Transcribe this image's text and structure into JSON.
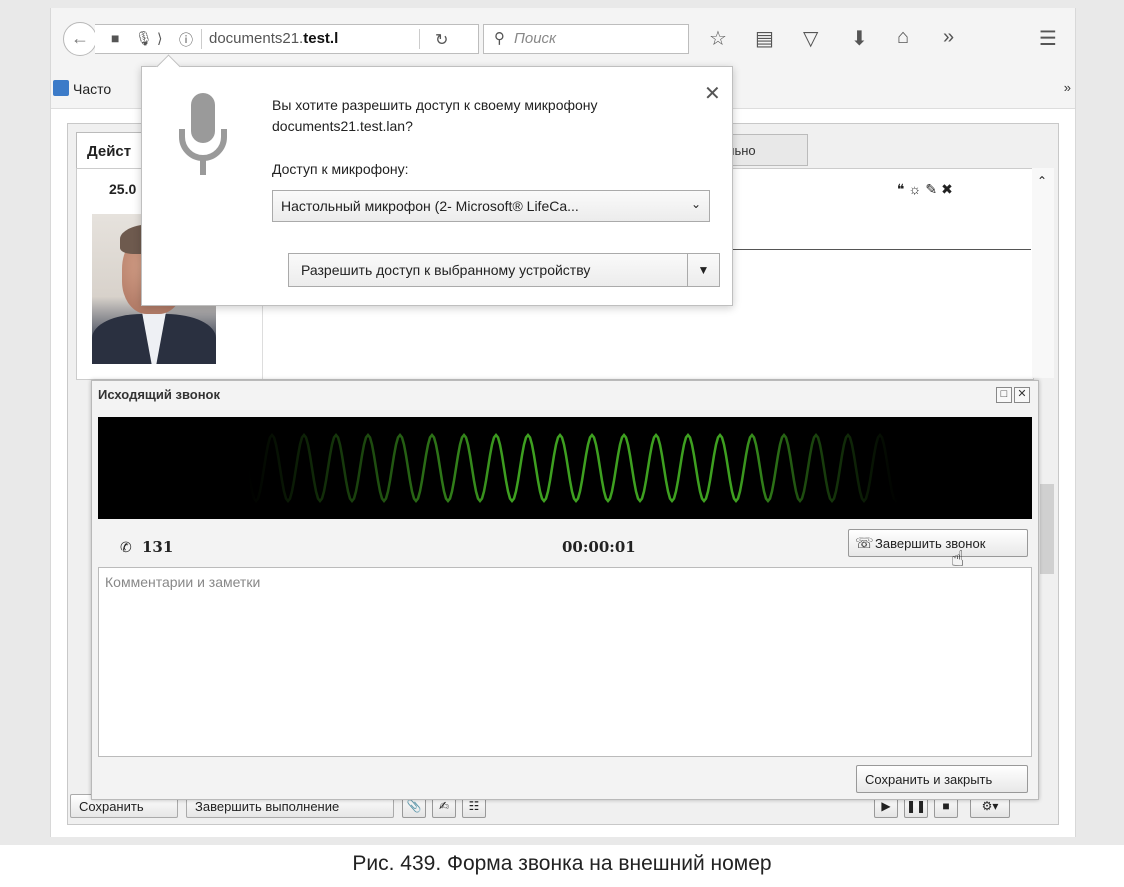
{
  "browser": {
    "url_prefix": "documents21.",
    "url_bold": "test.l",
    "search_placeholder": "Поиск",
    "bookmarks_label": "Часто",
    "bookmarks_more": "»"
  },
  "permission": {
    "message": "Вы хотите разрешить доступ к своему микрофону documents21.test.lan?",
    "label": "Доступ к микрофону:",
    "selected_device": "Настольный микрофон (2- Microsoft® LifeCa...",
    "allow_button": "Разрешить доступ к выбранному устройству",
    "close": "✕"
  },
  "app": {
    "tab_active": "Дейст",
    "tab_partial": "ительно",
    "date": "25.0",
    "save_button": "Сохранить",
    "finish_button": "Завершить выполнение"
  },
  "call": {
    "title": "Исходящий звонок",
    "number": "131",
    "timer": "00:00:01",
    "end_button": "Завершить звонок",
    "notes_placeholder": "Комментарии и заметки",
    "save_close_button": "Сохранить и закрыть"
  },
  "caption": "Рис. 439. Форма звонка на внешний номер",
  "colors": {
    "wave": "#3ea020",
    "wave_bg": "#000000"
  }
}
